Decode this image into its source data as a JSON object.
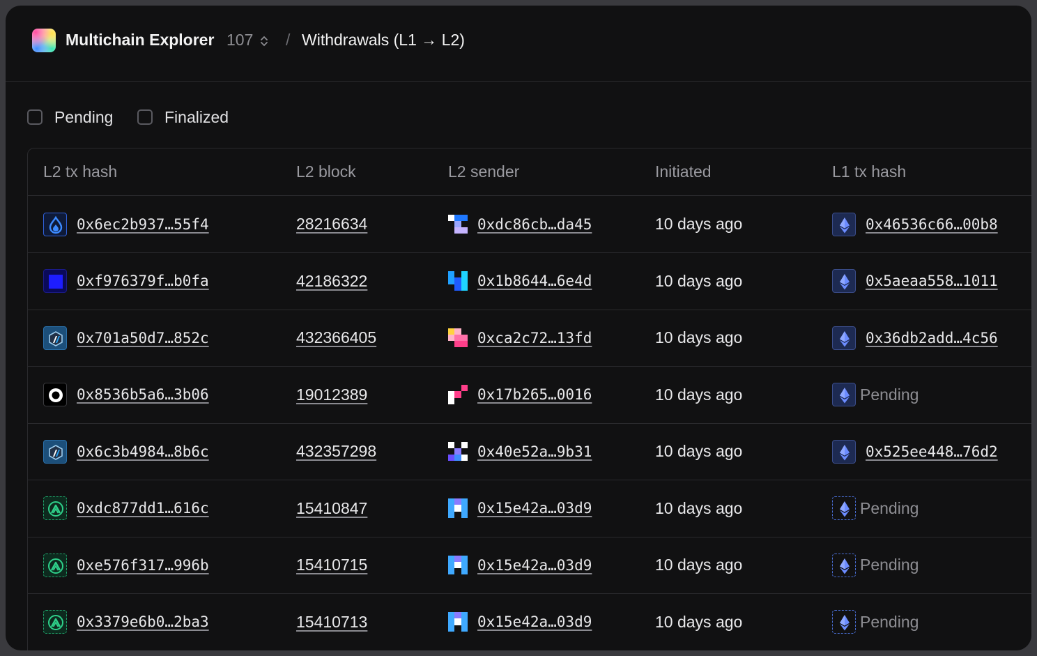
{
  "header": {
    "app_title": "Multichain Explorer",
    "chain_count": "107",
    "separator": "/",
    "page_title": "Withdrawals (L1 → L2)"
  },
  "filters": [
    {
      "label": "Pending",
      "checked": false
    },
    {
      "label": "Finalized",
      "checked": false
    }
  ],
  "table": {
    "columns": [
      "L2 tx hash",
      "L2 block",
      "L2 sender",
      "Initiated",
      "L1 tx hash"
    ],
    "rows": [
      {
        "chain_icon": "blue-flame-icon",
        "l2_tx_hash": "0x6ec2b937…55f4",
        "l2_block": "28216634",
        "sender_identicon": [
          "#ffffff",
          "#1f78ff",
          "#1f78ff",
          "#111112",
          "#9aa7ff",
          "#111112",
          "#111112",
          "#c5b4ff",
          "#c5b4ff"
        ],
        "sender": "0xdc86cb…da45",
        "initiated": "10 days ago",
        "l1_icon": "ethereum-icon",
        "l1_style": "solid",
        "l1_tx_hash": "0x46536c66…00b8",
        "l1_pending": false
      },
      {
        "chain_icon": "blue-square-icon",
        "l2_tx_hash": "0xf976379f…b0fa",
        "l2_block": "42186322",
        "sender_identicon": [
          "#1fa0ff",
          "#111112",
          "#1fd3ff",
          "#1fa0ff",
          "#1f5bff",
          "#1fd3ff",
          "#111112",
          "#1f5bff",
          "#1fd3ff"
        ],
        "sender": "0x1b8644…6e4d",
        "initiated": "10 days ago",
        "l1_icon": "ethereum-icon",
        "l1_style": "solid",
        "l1_tx_hash": "0x5aeaa558…1011",
        "l1_pending": false
      },
      {
        "chain_icon": "arbitrum-icon",
        "l2_tx_hash": "0x701a50d7…852c",
        "l2_block": "432366405",
        "sender_identicon": [
          "#ffd23f",
          "#ffb3c7",
          "#111112",
          "#ffb3c7",
          "#ff6fa8",
          "#ff6fa8",
          "#111112",
          "#ff3f8a",
          "#ff3f8a"
        ],
        "sender": "0xca2c72…13fd",
        "initiated": "10 days ago",
        "l1_icon": "ethereum-icon",
        "l1_style": "solid",
        "l1_tx_hash": "0x36db2add…4c56",
        "l1_pending": false
      },
      {
        "chain_icon": "optimism-ring-icon",
        "l2_tx_hash": "0x8536b5a6…3b06",
        "l2_block": "19012389",
        "sender_identicon": [
          "#111112",
          "#111112",
          "#ff3f8a",
          "#ffffff",
          "#ff3f8a",
          "#111112",
          "#ffffff",
          "#111112",
          "#111112"
        ],
        "sender": "0x17b265…0016",
        "initiated": "10 days ago",
        "l1_icon": "ethereum-icon",
        "l1_style": "solid",
        "l1_tx_hash": "",
        "l1_pending": true,
        "l1_status": "Pending"
      },
      {
        "chain_icon": "arbitrum-icon",
        "l2_tx_hash": "0x6c3b4984…8b6c",
        "l2_block": "432357298",
        "sender_identicon": [
          "#ffffff",
          "#111112",
          "#ffffff",
          "#111112",
          "#8a7bff",
          "#111112",
          "#6a4dff",
          "#3f8cff",
          "#ffffff"
        ],
        "sender": "0x40e52a…9b31",
        "initiated": "10 days ago",
        "l1_icon": "ethereum-icon",
        "l1_style": "solid",
        "l1_tx_hash": "0x525ee448…76d2",
        "l1_pending": false
      },
      {
        "chain_icon": "green-arch-icon",
        "l2_tx_hash": "0xdc877dd1…616c",
        "l2_block": "15410847",
        "sender_identicon": [
          "#3fa9ff",
          "#8a7bff",
          "#3fa9ff",
          "#3fa9ff",
          "#ffffff",
          "#3fa9ff",
          "#3fa9ff",
          "#111112",
          "#3fa9ff"
        ],
        "sender": "0x15e42a…03d9",
        "initiated": "10 days ago",
        "l1_icon": "ethereum-icon",
        "l1_style": "dashed",
        "l1_tx_hash": "",
        "l1_pending": true,
        "l1_status": "Pending"
      },
      {
        "chain_icon": "green-arch-icon",
        "l2_tx_hash": "0xe576f317…996b",
        "l2_block": "15410715",
        "sender_identicon": [
          "#3fa9ff",
          "#8a7bff",
          "#3fa9ff",
          "#3fa9ff",
          "#ffffff",
          "#3fa9ff",
          "#3fa9ff",
          "#111112",
          "#3fa9ff"
        ],
        "sender": "0x15e42a…03d9",
        "initiated": "10 days ago",
        "l1_icon": "ethereum-icon",
        "l1_style": "dashed",
        "l1_tx_hash": "",
        "l1_pending": true,
        "l1_status": "Pending"
      },
      {
        "chain_icon": "green-arch-icon",
        "l2_tx_hash": "0x3379e6b0…2ba3",
        "l2_block": "15410713",
        "sender_identicon": [
          "#3fa9ff",
          "#8a7bff",
          "#3fa9ff",
          "#3fa9ff",
          "#ffffff",
          "#3fa9ff",
          "#3fa9ff",
          "#111112",
          "#3fa9ff"
        ],
        "sender": "0x15e42a…03d9",
        "initiated": "10 days ago",
        "l1_icon": "ethereum-icon",
        "l1_style": "dashed",
        "l1_tx_hash": "",
        "l1_pending": true,
        "l1_status": "Pending"
      }
    ]
  }
}
